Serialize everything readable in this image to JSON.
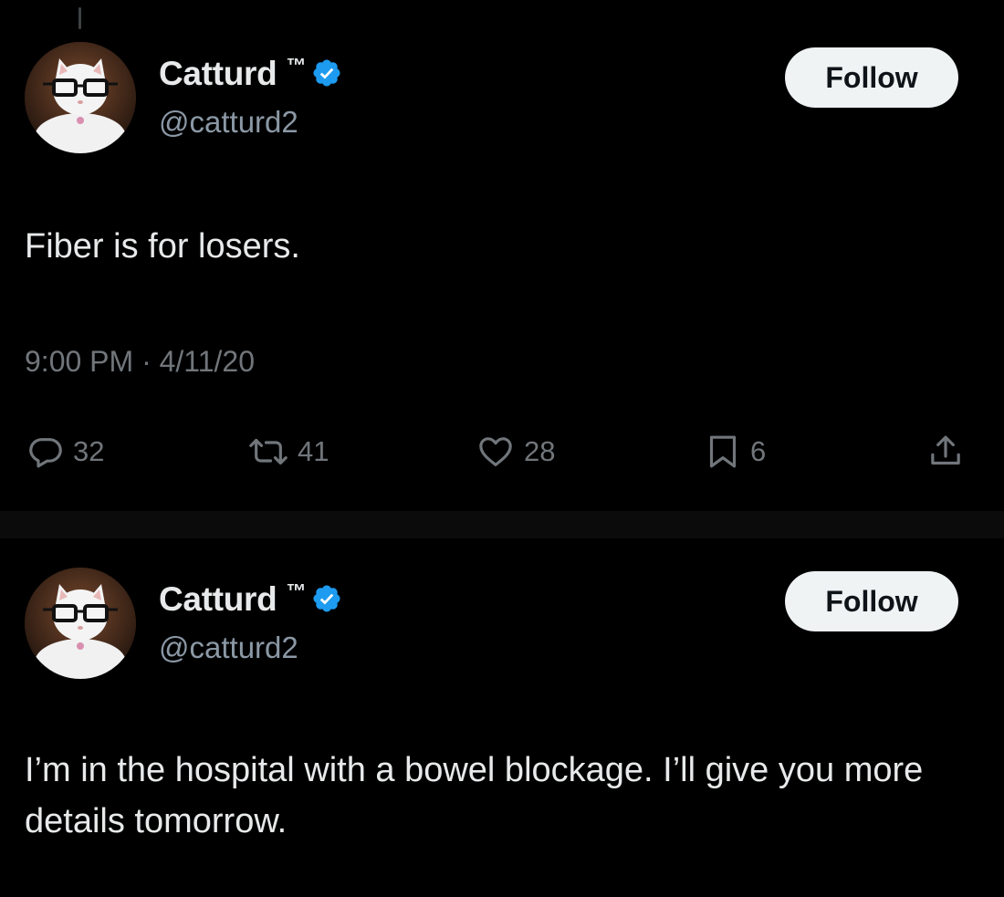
{
  "tweets": [
    {
      "author": {
        "display_name": "Catturd",
        "badge_text": "™",
        "handle": "@catturd2",
        "verified": true
      },
      "follow_label": "Follow",
      "text": "Fiber is for losers.",
      "timestamp": "9:00 PM · 4/11/20",
      "metrics": {
        "replies": "32",
        "retweets": "41",
        "likes": "28",
        "bookmarks": "6"
      }
    },
    {
      "author": {
        "display_name": "Catturd",
        "badge_text": "™",
        "handle": "@catturd2",
        "verified": true
      },
      "follow_label": "Follow",
      "text": "I’m in the hospital with a bowel blockage. I’ll give you more details tomorrow."
    }
  ],
  "colors": {
    "background": "#000000",
    "primary_text": "#e7e9ea",
    "secondary_text": "#71767b",
    "verified_blue": "#1d9bf0",
    "follow_button_bg": "#eff3f4",
    "follow_button_text": "#0f1419"
  },
  "icons": {
    "reply": "reply-icon",
    "retweet": "retweet-icon",
    "like": "heart-icon",
    "bookmark": "bookmark-icon",
    "share": "share-icon",
    "verified": "verified-badge-icon"
  }
}
